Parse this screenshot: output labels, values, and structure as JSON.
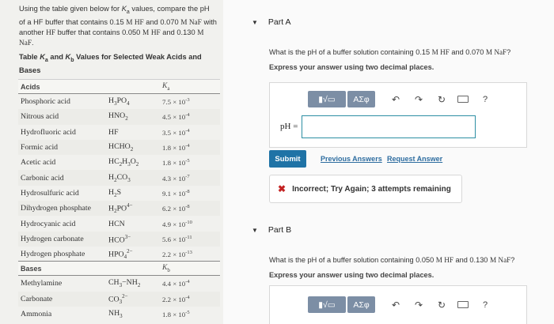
{
  "problem": {
    "intro": "Using the table given below for Ka values, compare the pH of a HF buffer that contains 0.15 M HF and 0.070 M NaF with another HF buffer that contains 0.050 M HF and 0.130 M NaF.",
    "table_title": "Table Ka and Kb Values for Selected Weak Acids and Bases"
  },
  "table": {
    "acids_header": "Acids",
    "ka_header": "Ka",
    "acids": [
      {
        "name": "Phosphoric acid",
        "formula": "H3PO4",
        "k": "7.5 × 10^-3"
      },
      {
        "name": "Nitrous acid",
        "formula": "HNO2",
        "k": "4.5 × 10^-4"
      },
      {
        "name": "Hydrofluoric acid",
        "formula": "HF",
        "k": "3.5 × 10^-4"
      },
      {
        "name": "Formic acid",
        "formula": "HCHO2",
        "k": "1.8 × 10^-4"
      },
      {
        "name": "Acetic acid",
        "formula": "HC2H3O2",
        "k": "1.8 × 10^-5"
      },
      {
        "name": "Carbonic acid",
        "formula": "H2CO3",
        "k": "4.3 × 10^-7"
      },
      {
        "name": "Hydrosulfuric acid",
        "formula": "H2S",
        "k": "9.1 × 10^-8"
      },
      {
        "name": "Dihydrogen phosphate",
        "formula": "H2PO4−",
        "k": "6.2 × 10^-8"
      },
      {
        "name": "Hydrocyanic acid",
        "formula": "HCN",
        "k": "4.9 × 10^-10"
      },
      {
        "name": "Hydrogen carbonate",
        "formula": "HCO3−",
        "k": "5.6 × 10^-11"
      },
      {
        "name": "Hydrogen phosphate",
        "formula": "HPO42−",
        "k": "2.2 × 10^-13"
      }
    ],
    "bases_header": "Bases",
    "kb_header": "Kb",
    "bases": [
      {
        "name": "Methylamine",
        "formula": "CH3−NH2",
        "k": "4.4 × 10^-4"
      },
      {
        "name": "Carbonate",
        "formula": "CO32−",
        "k": "2.2 × 10^-4"
      },
      {
        "name": "Ammonia",
        "formula": "NH3",
        "k": "1.8 × 10^-5"
      }
    ]
  },
  "part_a": {
    "title": "Part A",
    "question": "What is the pH of a buffer solution containing 0.15 M HF and 0.070 M NaF?",
    "instruction": "Express your answer using two decimal places.",
    "input_label": "pH =",
    "input_value": "",
    "submit_label": "Submit",
    "previous_answers_label": "Previous Answers",
    "request_answer_label": "Request Answer",
    "feedback": "Incorrect; Try Again; 3 attempts remaining"
  },
  "part_b": {
    "title": "Part B",
    "question": "What is the pH of a buffer solution containing 0.050 M HF and 0.130 M NaF?",
    "instruction": "Express your answer using two decimal places."
  },
  "toolbar": {
    "templates_label": "▮√▭",
    "symbols_label": "ΑΣφ",
    "undo_icon": "undo-icon",
    "redo_icon": "redo-icon",
    "reset_icon": "reset-icon",
    "keyboard_icon": "keyboard-icon",
    "help_label": "?"
  },
  "colors": {
    "submit": "#1f73a6",
    "toolbar_button": "#7c8ea5",
    "input_border": "#2d8fa3",
    "incorrect": "#c32222",
    "link": "#2e6da0"
  }
}
